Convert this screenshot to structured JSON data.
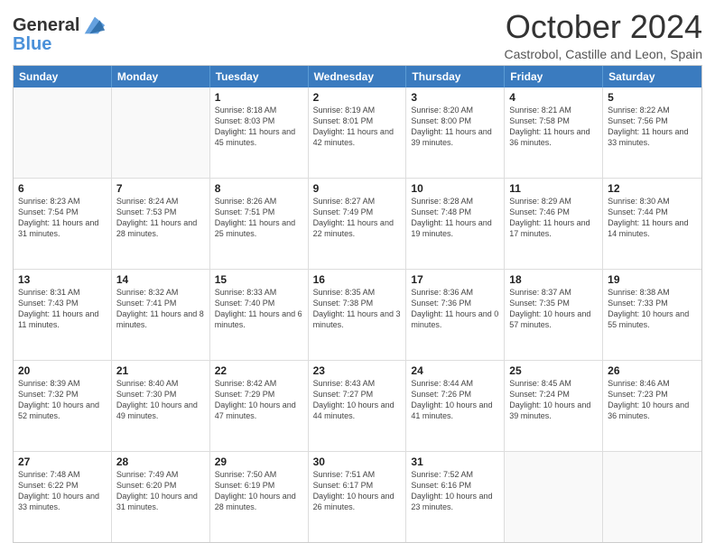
{
  "header": {
    "logo_line1": "General",
    "logo_line2": "Blue",
    "title": "October 2024",
    "subtitle": "Castrobol, Castille and Leon, Spain"
  },
  "weekdays": [
    "Sunday",
    "Monday",
    "Tuesday",
    "Wednesday",
    "Thursday",
    "Friday",
    "Saturday"
  ],
  "rows": [
    [
      {
        "day": "",
        "info": ""
      },
      {
        "day": "",
        "info": ""
      },
      {
        "day": "1",
        "info": "Sunrise: 8:18 AM\nSunset: 8:03 PM\nDaylight: 11 hours and 45 minutes."
      },
      {
        "day": "2",
        "info": "Sunrise: 8:19 AM\nSunset: 8:01 PM\nDaylight: 11 hours and 42 minutes."
      },
      {
        "day": "3",
        "info": "Sunrise: 8:20 AM\nSunset: 8:00 PM\nDaylight: 11 hours and 39 minutes."
      },
      {
        "day": "4",
        "info": "Sunrise: 8:21 AM\nSunset: 7:58 PM\nDaylight: 11 hours and 36 minutes."
      },
      {
        "day": "5",
        "info": "Sunrise: 8:22 AM\nSunset: 7:56 PM\nDaylight: 11 hours and 33 minutes."
      }
    ],
    [
      {
        "day": "6",
        "info": "Sunrise: 8:23 AM\nSunset: 7:54 PM\nDaylight: 11 hours and 31 minutes."
      },
      {
        "day": "7",
        "info": "Sunrise: 8:24 AM\nSunset: 7:53 PM\nDaylight: 11 hours and 28 minutes."
      },
      {
        "day": "8",
        "info": "Sunrise: 8:26 AM\nSunset: 7:51 PM\nDaylight: 11 hours and 25 minutes."
      },
      {
        "day": "9",
        "info": "Sunrise: 8:27 AM\nSunset: 7:49 PM\nDaylight: 11 hours and 22 minutes."
      },
      {
        "day": "10",
        "info": "Sunrise: 8:28 AM\nSunset: 7:48 PM\nDaylight: 11 hours and 19 minutes."
      },
      {
        "day": "11",
        "info": "Sunrise: 8:29 AM\nSunset: 7:46 PM\nDaylight: 11 hours and 17 minutes."
      },
      {
        "day": "12",
        "info": "Sunrise: 8:30 AM\nSunset: 7:44 PM\nDaylight: 11 hours and 14 minutes."
      }
    ],
    [
      {
        "day": "13",
        "info": "Sunrise: 8:31 AM\nSunset: 7:43 PM\nDaylight: 11 hours and 11 minutes."
      },
      {
        "day": "14",
        "info": "Sunrise: 8:32 AM\nSunset: 7:41 PM\nDaylight: 11 hours and 8 minutes."
      },
      {
        "day": "15",
        "info": "Sunrise: 8:33 AM\nSunset: 7:40 PM\nDaylight: 11 hours and 6 minutes."
      },
      {
        "day": "16",
        "info": "Sunrise: 8:35 AM\nSunset: 7:38 PM\nDaylight: 11 hours and 3 minutes."
      },
      {
        "day": "17",
        "info": "Sunrise: 8:36 AM\nSunset: 7:36 PM\nDaylight: 11 hours and 0 minutes."
      },
      {
        "day": "18",
        "info": "Sunrise: 8:37 AM\nSunset: 7:35 PM\nDaylight: 10 hours and 57 minutes."
      },
      {
        "day": "19",
        "info": "Sunrise: 8:38 AM\nSunset: 7:33 PM\nDaylight: 10 hours and 55 minutes."
      }
    ],
    [
      {
        "day": "20",
        "info": "Sunrise: 8:39 AM\nSunset: 7:32 PM\nDaylight: 10 hours and 52 minutes."
      },
      {
        "day": "21",
        "info": "Sunrise: 8:40 AM\nSunset: 7:30 PM\nDaylight: 10 hours and 49 minutes."
      },
      {
        "day": "22",
        "info": "Sunrise: 8:42 AM\nSunset: 7:29 PM\nDaylight: 10 hours and 47 minutes."
      },
      {
        "day": "23",
        "info": "Sunrise: 8:43 AM\nSunset: 7:27 PM\nDaylight: 10 hours and 44 minutes."
      },
      {
        "day": "24",
        "info": "Sunrise: 8:44 AM\nSunset: 7:26 PM\nDaylight: 10 hours and 41 minutes."
      },
      {
        "day": "25",
        "info": "Sunrise: 8:45 AM\nSunset: 7:24 PM\nDaylight: 10 hours and 39 minutes."
      },
      {
        "day": "26",
        "info": "Sunrise: 8:46 AM\nSunset: 7:23 PM\nDaylight: 10 hours and 36 minutes."
      }
    ],
    [
      {
        "day": "27",
        "info": "Sunrise: 7:48 AM\nSunset: 6:22 PM\nDaylight: 10 hours and 33 minutes."
      },
      {
        "day": "28",
        "info": "Sunrise: 7:49 AM\nSunset: 6:20 PM\nDaylight: 10 hours and 31 minutes."
      },
      {
        "day": "29",
        "info": "Sunrise: 7:50 AM\nSunset: 6:19 PM\nDaylight: 10 hours and 28 minutes."
      },
      {
        "day": "30",
        "info": "Sunrise: 7:51 AM\nSunset: 6:17 PM\nDaylight: 10 hours and 26 minutes."
      },
      {
        "day": "31",
        "info": "Sunrise: 7:52 AM\nSunset: 6:16 PM\nDaylight: 10 hours and 23 minutes."
      },
      {
        "day": "",
        "info": ""
      },
      {
        "day": "",
        "info": ""
      }
    ]
  ]
}
